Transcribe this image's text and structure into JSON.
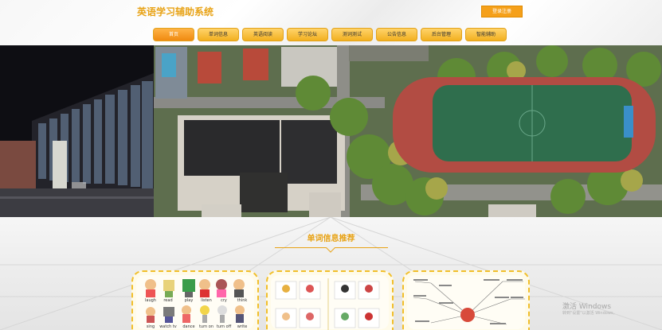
{
  "header": {
    "site_title": "英语学习辅助系统",
    "login_label": "登录注册"
  },
  "nav": {
    "items": [
      {
        "label": "首页",
        "active": true
      },
      {
        "label": "单词信息",
        "active": false
      },
      {
        "label": "英语阅读",
        "active": false
      },
      {
        "label": "学习论坛",
        "active": false
      },
      {
        "label": "测词测试",
        "active": false
      },
      {
        "label": "公告信息",
        "active": false
      },
      {
        "label": "后台管理",
        "active": false
      },
      {
        "label": "智能辅助",
        "active": false
      }
    ]
  },
  "section": {
    "title": "单词信息推荐"
  },
  "card1": {
    "words": [
      "laugh",
      "read",
      "play",
      "listen",
      "cry",
      "think",
      "sing",
      "watch tv",
      "dance",
      "turn on",
      "turn off",
      "write"
    ]
  },
  "watermark": {
    "line1": "激活 Windows",
    "line2": "转到\"设置\"以激活 Windows。"
  },
  "colors": {
    "accent": "#e8a317",
    "nav_bg": "#f2b020",
    "nav_active": "#f08a10"
  }
}
